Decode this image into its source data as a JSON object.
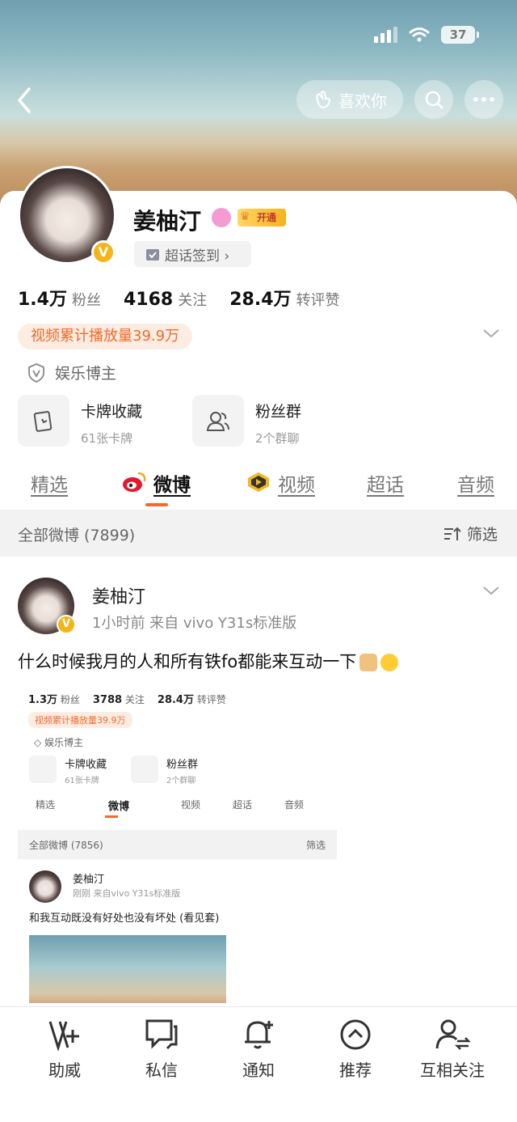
{
  "status": {
    "battery": "37"
  },
  "header": {
    "like_label": "喜欢你"
  },
  "profile": {
    "name": "姜柚汀",
    "vip_label": "开通",
    "checkin_label": "超话签到 ›",
    "stats": [
      {
        "value": "1.4万",
        "label": "粉丝"
      },
      {
        "value": "4168",
        "label": "关注"
      },
      {
        "value": "28.4万",
        "label": "转评赞"
      }
    ],
    "play_tag": "视频累计播放量39.9万",
    "role": "娱乐博主",
    "features": [
      {
        "title": "卡牌收藏",
        "sub": "61张卡牌",
        "icon": "card-icon"
      },
      {
        "title": "粉丝群",
        "sub": "2个群聊",
        "icon": "group-icon"
      }
    ]
  },
  "tabs": [
    {
      "label": "精选"
    },
    {
      "label": "微博"
    },
    {
      "label": "视频"
    },
    {
      "label": "超话"
    },
    {
      "label": "音频"
    }
  ],
  "filter": {
    "all_label": "全部微博 (7899)",
    "filter_label": "筛选"
  },
  "post": {
    "author": "姜柚汀",
    "meta": "1小时前  来自 vivo Y31s标准版",
    "text": "什么时候我月的人和所有铁fo都能来互动一下",
    "embedded": {
      "stats": [
        {
          "value": "1.3万",
          "label": "粉丝"
        },
        {
          "value": "3788",
          "label": "关注"
        },
        {
          "value": "28.4万",
          "label": "转评赞"
        }
      ],
      "play_tag": "视频累计播放量39.9万",
      "role": "娱乐博主",
      "features": [
        {
          "title": "卡牌收藏",
          "sub": "61张卡牌"
        },
        {
          "title": "粉丝群",
          "sub": "2个群聊"
        }
      ],
      "tabs": [
        "精选",
        "微博",
        "视频",
        "超话",
        "音频"
      ],
      "all_label": "全部微博 (7856)",
      "filter_label": "筛选",
      "author": "姜柚汀",
      "meta": "刚刚  来自vivo Y31s标准版",
      "text": "和我互动既没有好处也没有坏处 (看见套)"
    }
  },
  "bottom": [
    {
      "label": "助威",
      "icon": "cheer-icon"
    },
    {
      "label": "私信",
      "icon": "message-icon"
    },
    {
      "label": "通知",
      "icon": "notify-icon"
    },
    {
      "label": "推荐",
      "icon": "recommend-icon"
    },
    {
      "label": "互相关注",
      "icon": "follow-each-icon"
    }
  ],
  "colors": {
    "accent": "#f26a2c",
    "vip": "#f5b51a"
  }
}
